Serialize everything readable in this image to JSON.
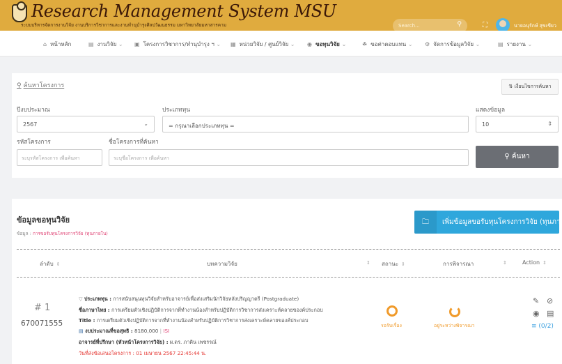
{
  "header": {
    "app_title": "Research Management System MSU",
    "subtitle": "ระบบบริหารจัดการงานวิจัย งานบริการวิชาการและงานทำนุบำรุงศิลปวัฒนธรรม มหาวิทยาลัยมหาสารคาม",
    "search_placeholder": "Search...",
    "user_name": "นายอนุรักษ์ สุขเขียว"
  },
  "nav": {
    "items": [
      {
        "icon": "home-icon",
        "label": "หน้าหลัก"
      },
      {
        "icon": "list-icon",
        "label": "งานวิจัย"
      },
      {
        "icon": "clipboard-icon",
        "label": "โครงการวิชาการ/ทำนุบำรุง ฯ"
      },
      {
        "icon": "building-icon",
        "label": "หน่วยวิจัย / ศูนย์วิจัย"
      },
      {
        "icon": "target-icon",
        "label": "ขอทุนวิจัย"
      },
      {
        "icon": "hands-icon",
        "label": "ขอค่าตอบแทน"
      },
      {
        "icon": "gear-icon",
        "label": "จัดการข้อมูลวิจัย"
      },
      {
        "icon": "report-icon",
        "label": "รายงาน"
      }
    ]
  },
  "search_panel": {
    "search_link": "ค้นหาโครงการ",
    "advanced_button": "เงื่อนไขการค้นหา",
    "fiscal_year_label": "ปีงบประมาณ",
    "fiscal_year_value": "2567",
    "fund_type_label": "ประเภททุน",
    "fund_type_value": "= กรุณาเลือกประเภททุน =",
    "show_label": "แสดงข้อมูล",
    "show_value": "10",
    "project_code_label": "รหัสโครงการ",
    "project_code_placeholder": "ระบุรหัสโครงการ เพื่อค้นหา",
    "project_name_label": "ชื่อโครงการที่ค้นหา",
    "project_name_placeholder": "ระบุชื่อโครงการ เพื่อค้นหา",
    "search_button": "ค้นหา"
  },
  "data_panel": {
    "title": "ข้อมูลขอทุนวิจัย",
    "sub_label": "ข้อมูล :",
    "sub_value": "การขอรับทุนโครงการวิจัย (ทุนภายใน)",
    "add_button": "เพิ่มข้อมูลขอรับทุนโครงการวิจัย (ทุนภายใน)",
    "columns": [
      "ลำดับ",
      "บทความวิจัย",
      "สถานะ",
      "การพิจารณา",
      "Action"
    ]
  },
  "row": {
    "num": "# 1",
    "code": "670071555",
    "fund_type_label": "ประเภททุน :",
    "fund_type_value": "การสนับสนุนทุนวิจัยสำหรับอาจารย์เพื่อส่งเสริมนักวิจัยหลังปริญญาตรี (Postgraduate)",
    "thai_name_label": "ชื่อภาษาไทย :",
    "thai_name_value": "การเตรียมตัวเชิงปฏิบัติการจากที่ทำงานน้องสำหรับปฏิบัติการวิชาการส่งเคราะห์คลายของค์ประกอบ",
    "title_label": "Title :",
    "title_value": "การเตรียมตัวเชิงปฏิบัติการจากที่ทำงานน้องสำหรับปฏิบัติการวิชาการส่งเคราะห์คลายของค์ประกอบ",
    "budget_label": "งบประมาณที่ขอสุทธิ :",
    "budget_value": "8180,000",
    "budget_suffix": "ISI",
    "advisor_label": "อาจารย์ที่ปรึกษา (หัวหน้าโครงการวิจัย) :",
    "advisor_value": "ผ.ดร. ภาคิน เพชรรณ์",
    "submitted_label": "วันที่ส่งข้อเสนอโครงการ :",
    "submitted_value": "01 เมษายน 2567 22:45:44 น.",
    "status_label": "รอรับเรื่อง",
    "review_label": "อยู่ระหว่างพิจารณา",
    "file_count": "(0/2)"
  },
  "colors": {
    "header_bg": "#e0ab3e",
    "primary_button": "#2fa7dc",
    "search_button": "#6b6e74",
    "status_orange": "#f09a2a",
    "pink": "#e04878"
  }
}
